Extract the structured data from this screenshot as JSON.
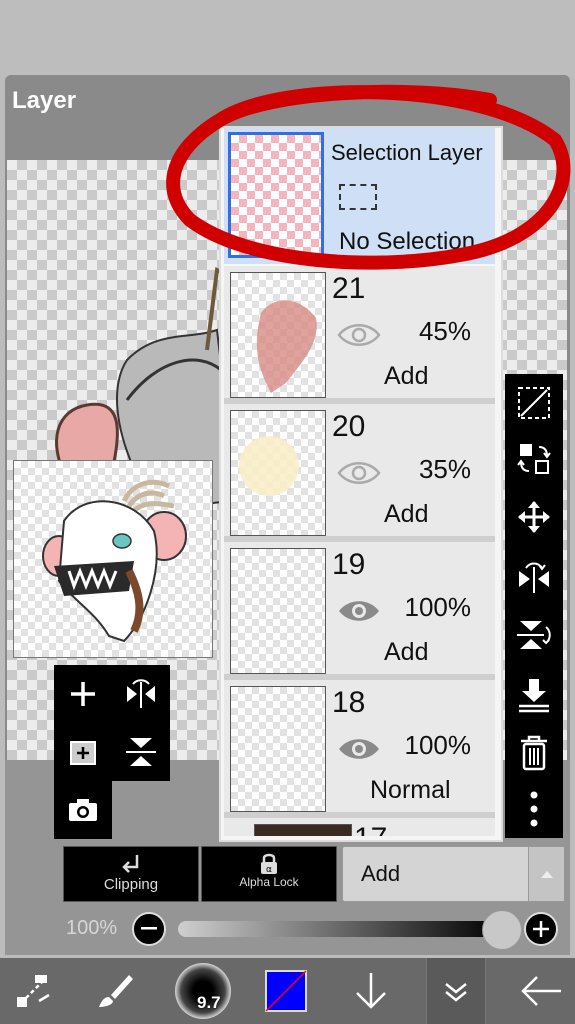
{
  "panel": {
    "title": "Layer"
  },
  "selection_layer": {
    "name": "Selection Layer",
    "status": "No Selection"
  },
  "layers": [
    {
      "number": "21",
      "opacity": "45%",
      "blend": "Add",
      "visible": true
    },
    {
      "number": "20",
      "opacity": "35%",
      "blend": "Add",
      "visible": true
    },
    {
      "number": "19",
      "opacity": "100%",
      "blend": "Add",
      "visible": true
    },
    {
      "number": "18",
      "opacity": "100%",
      "blend": "Normal",
      "visible": true
    },
    {
      "number": "17"
    }
  ],
  "left_tools": {
    "add": "add-layer",
    "flip_h": "flip-horizontal",
    "add_image": "add-image",
    "flip_v": "flip-vertical",
    "camera": "camera"
  },
  "right_tools": [
    "select-none-icon",
    "transform-icon",
    "move-icon",
    "flip-horizontal-icon",
    "flip-vertical-icon",
    "merge-down-icon",
    "delete-icon",
    "more-icon"
  ],
  "bottom_controls": {
    "clipping_label": "Clipping",
    "alpha_lock_label": "Alpha Lock",
    "blend_mode": "Add",
    "opacity_label": "100%",
    "opacity_value": 1.0
  },
  "toolbar": {
    "brush_size": "9.7",
    "color": "#0000ff",
    "items": [
      "transform-tools-icon",
      "brush-icon",
      "brush-size",
      "color-swatch",
      "down-arrow-icon",
      "layers-collapse-icon",
      "back-arrow-icon"
    ]
  },
  "colors": {
    "accent_red": "#d10000",
    "selection_blue": "#2f6fe0",
    "selection_bg": "#cfe0f6"
  }
}
